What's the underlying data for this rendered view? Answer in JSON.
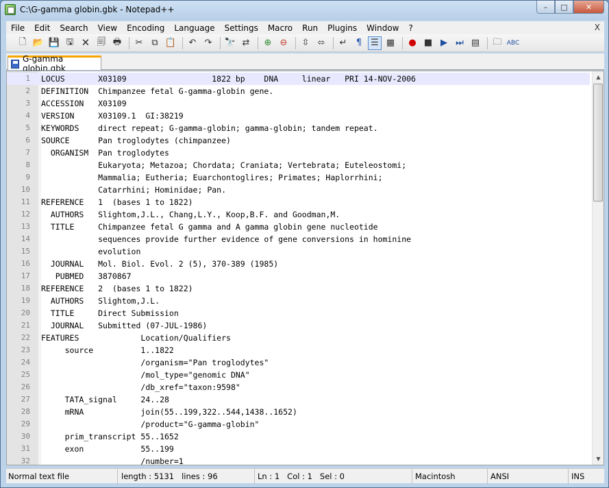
{
  "window": {
    "title": "C:\\G-gamma globin.gbk - Notepad++",
    "minimize": "–",
    "maximize": "□",
    "close": "✕"
  },
  "menu": {
    "items": [
      "File",
      "Edit",
      "Search",
      "View",
      "Encoding",
      "Language",
      "Settings",
      "Macro",
      "Run",
      "Plugins",
      "Window",
      "?"
    ],
    "close": "X"
  },
  "tab": {
    "label": "G-gamma globin.gbk"
  },
  "editor": {
    "current_line": 1,
    "lines": [
      "LOCUS       X03109                  1822 bp    DNA     linear   PRI 14-NOV-2006",
      "DEFINITION  Chimpanzee fetal G-gamma-globin gene.",
      "ACCESSION   X03109",
      "VERSION     X03109.1  GI:38219",
      "KEYWORDS    direct repeat; G-gamma-globin; gamma-globin; tandem repeat.",
      "SOURCE      Pan troglodytes (chimpanzee)",
      "  ORGANISM  Pan troglodytes",
      "            Eukaryota; Metazoa; Chordata; Craniata; Vertebrata; Euteleostomi;",
      "            Mammalia; Eutheria; Euarchontoglires; Primates; Haplorrhini;",
      "            Catarrhini; Hominidae; Pan.",
      "REFERENCE   1  (bases 1 to 1822)",
      "  AUTHORS   Slightom,J.L., Chang,L.Y., Koop,B.F. and Goodman,M.",
      "  TITLE     Chimpanzee fetal G gamma and A gamma globin gene nucleotide",
      "            sequences provide further evidence of gene conversions in hominine",
      "            evolution",
      "  JOURNAL   Mol. Biol. Evol. 2 (5), 370-389 (1985)",
      "   PUBMED   3870867",
      "REFERENCE   2  (bases 1 to 1822)",
      "  AUTHORS   Slightom,J.L.",
      "  TITLE     Direct Submission",
      "  JOURNAL   Submitted (07-JUL-1986)",
      "FEATURES             Location/Qualifiers",
      "     source          1..1822",
      "                     /organism=\"Pan troglodytes\"",
      "                     /mol_type=\"genomic DNA\"",
      "                     /db_xref=\"taxon:9598\"",
      "     TATA_signal     24..28",
      "     mRNA            join(55..199,322..544,1438..1652)",
      "                     /product=\"G-gamma-globin\"",
      "     prim_transcript 55..1652",
      "     exon            55..199",
      "                     /number=1"
    ]
  },
  "toolbar": {
    "icons": [
      "new-file-icon",
      "open-file-icon",
      "save-icon",
      "save-all-icon",
      "close-icon",
      "close-all-icon",
      "print-icon",
      "sep",
      "cut-icon",
      "copy-icon",
      "paste-icon",
      "sep",
      "undo-icon",
      "redo-icon",
      "sep",
      "find-icon",
      "replace-icon",
      "sep",
      "zoom-in-icon",
      "zoom-out-icon",
      "sep",
      "sync-vertical-icon",
      "sync-horizontal-icon",
      "sep",
      "word-wrap-icon",
      "show-all-chars-icon",
      "indent-guide-icon",
      "user-lang-icon",
      "sep",
      "record-macro-icon",
      "stop-record-icon",
      "play-macro-icon",
      "run-macro-multiple-icon",
      "save-macro-icon",
      "sep",
      "trim-icon",
      "spellcheck-icon"
    ]
  },
  "status": {
    "type": "Normal text file",
    "length": "length : 5131",
    "lines": "lines : 96",
    "ln": "Ln : 1",
    "col": "Col : 1",
    "sel": "Sel : 0",
    "eol": "Macintosh",
    "encoding": "ANSI",
    "mode": "INS"
  }
}
